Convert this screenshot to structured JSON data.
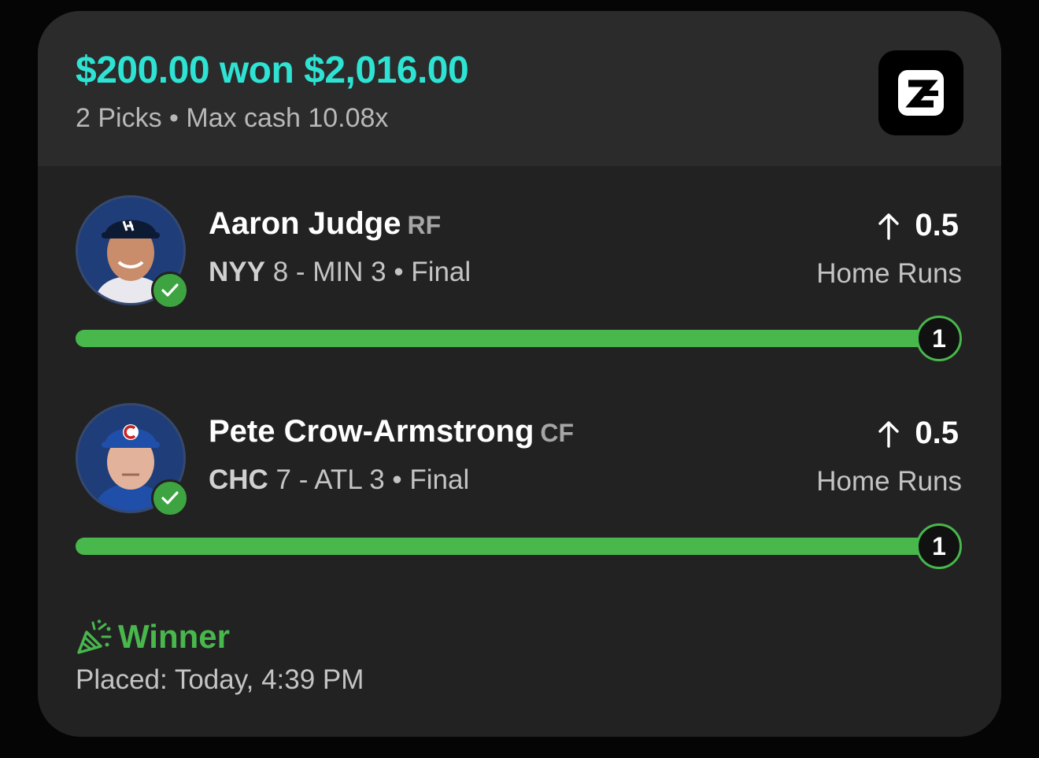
{
  "header": {
    "title": "$200.00 won $2,016.00",
    "subtitle": "2 Picks • Max cash 10.08x",
    "brand_icon": "brand-logo-icon",
    "accent_color": "#2ee3d3"
  },
  "picks": [
    {
      "player": "Aaron Judge",
      "position": "RF",
      "team": "NYY",
      "game_rest": " 8 - MIN 3 • Final",
      "direction_icon": "up-arrow-icon",
      "line": "0.5",
      "stat": "Home Runs",
      "result_value": "1",
      "progress_fraction": 1.0,
      "status_icon": "check-icon",
      "cap_color": "#0d1a33",
      "avatar_bg": "#1e3d79"
    },
    {
      "player": "Pete Crow-Armstrong",
      "position": "CF",
      "team": "CHC",
      "game_rest": " 7 - ATL 3 • Final",
      "direction_icon": "up-arrow-icon",
      "line": "0.5",
      "stat": "Home Runs",
      "result_value": "1",
      "progress_fraction": 1.0,
      "status_icon": "check-icon",
      "cap_color": "#1f4fa8",
      "avatar_bg": "#1e3d79"
    }
  ],
  "result": {
    "label": "Winner",
    "icon": "confetti-icon",
    "placed": "Placed: Today, 4:39 PM"
  },
  "colors": {
    "win_green": "#48b74c",
    "card_bg": "#222222",
    "header_bg": "#2b2b2b"
  }
}
